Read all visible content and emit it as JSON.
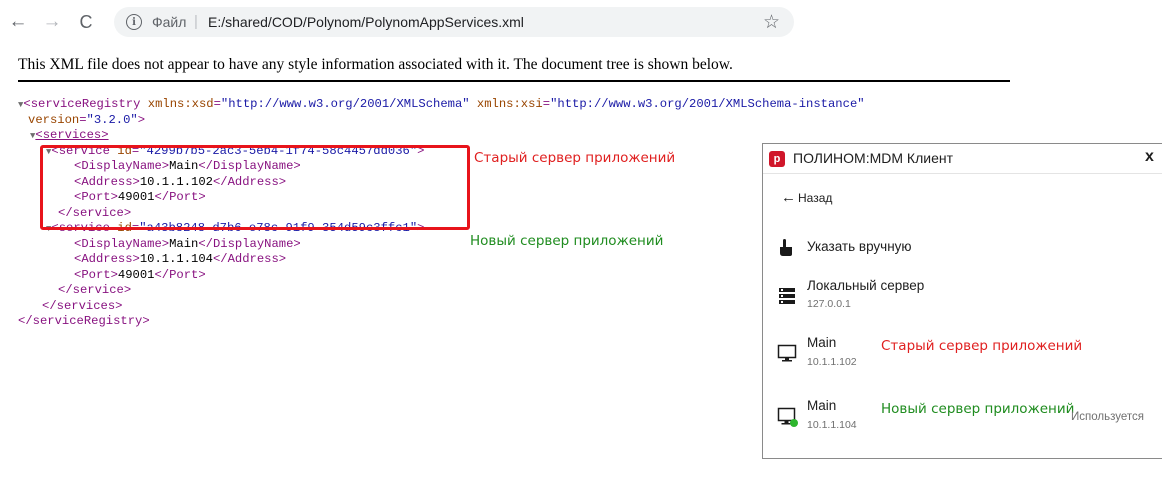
{
  "browser": {
    "back_icon": "←",
    "forward_icon": "→",
    "reload_icon": "C",
    "info_icon": "i",
    "scheme_label": "Файл",
    "url_separator": "|",
    "url": "E:/shared/COD/Polynom/PolynomAppServices.xml",
    "star_icon": "☆"
  },
  "xml_viewer": {
    "notice": "This XML file does not appear to have any style information associated with it. The document tree is shown below.",
    "tree": {
      "root_open": "<serviceRegistry",
      "attr1_name": "xmlns:xsd",
      "attr1_value": "\"http://www.w3.org/2001/XMLSchema\"",
      "attr2_name": "xmlns:xsi",
      "attr2_value": "\"http://www.w3.org/2001/XMLSchema-instance\"",
      "attr3_name": "version",
      "attr3_value": "\"3.2.0\"",
      "root_close_bracket": ">",
      "services_open": "<services>",
      "service_open": "<service",
      "id_attr": "id",
      "service1_id": "\"4299b7b5-2ac3-5eb4-1f74-58c4457dd036\"",
      "service2_id": "\"a43b8248-d7b6-e78c-91f9-354d59c3ffc1\"",
      "displayname_open": "<DisplayName>",
      "displayname_close": "</DisplayName>",
      "address_open": "<Address>",
      "address_close": "</Address>",
      "port_open": "<Port>",
      "port_close": "</Port>",
      "service_close": "</service>",
      "services_close": "</services>",
      "root_close": "</serviceRegistry>",
      "services": [
        {
          "display_name": "Main",
          "address": "10.1.1.102",
          "port": "49001"
        },
        {
          "display_name": "Main",
          "address": "10.1.1.104",
          "port": "49001"
        }
      ]
    },
    "annotation_old": "Старый сервер приложений",
    "annotation_new": "Новый сервер приложений"
  },
  "client_window": {
    "app_icon": "p",
    "title": "ПОЛИНОМ:MDM Клиент",
    "close_icon": "x",
    "back_arrow": "←",
    "back_label": "Назад",
    "manual_option": "Указать вручную",
    "local_server": {
      "name": "Локальный сервер",
      "address": "127.0.0.1"
    },
    "servers": [
      {
        "name": "Main",
        "address": "10.1.1.102",
        "note": "Старый сервер приложений",
        "badge": ""
      },
      {
        "name": "Main",
        "address": "10.1.1.104",
        "note": "Новый сервер приложений",
        "badge": "Используется"
      }
    ],
    "colors": {
      "red_note": "#e02020",
      "green_note": "#1f8c1f",
      "active_dot": "#2db52d",
      "brand": "#d0162a"
    }
  },
  "icons": {
    "manual": "hand-pointer-icon",
    "local": "server-rack-icon",
    "monitor": "monitor-icon",
    "monitor_active": "monitor-connected-icon"
  },
  "colors": {
    "tag": "#881280",
    "attr": "#994500",
    "value": "#1a1aa6",
    "highlight_box": "#e8141b"
  }
}
